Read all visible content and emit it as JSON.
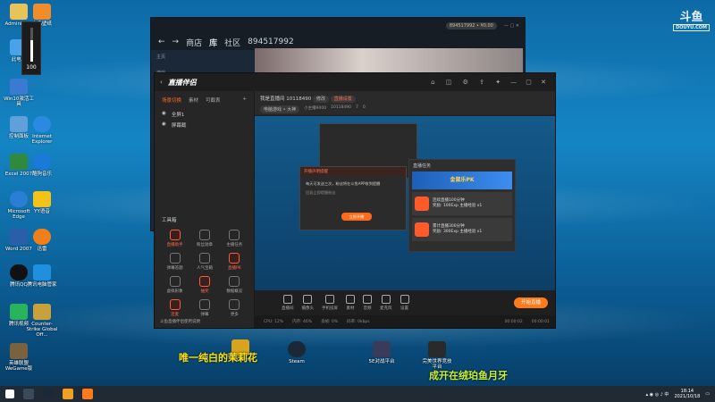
{
  "desktop": {
    "icons_left": [
      {
        "label": "Administr..."
      },
      {
        "label": "此电脑"
      },
      {
        "label": "Win10激活工具"
      },
      {
        "label": "控制面板"
      },
      {
        "label": "Excel 2007"
      },
      {
        "label": "Microsoft Edge"
      },
      {
        "label": "Word 2007"
      },
      {
        "label": "腾讯QQ"
      },
      {
        "label": "腾讯视频"
      },
      {
        "label": "英雄联盟 WeGame版"
      }
    ],
    "icons_col2": [
      {
        "label": "小鸟壁纸"
      },
      {
        "label": "Internet Explorer"
      },
      {
        "label": "酷狗音乐"
      },
      {
        "label": "YY语音"
      },
      {
        "label": "迅雷"
      },
      {
        "label": "腾讯电脑管家"
      },
      {
        "label": "Counter-Strike Global Off..."
      }
    ],
    "icons_bottom": [
      {
        "label": "WeGame"
      },
      {
        "label": "Steam"
      },
      {
        "label": "5E对战平台"
      },
      {
        "label": "完美世界竞技平台"
      }
    ],
    "volume_value": "100",
    "overlay_text_1": "唯一纯白的茉莉花",
    "overlay_text_2": "成开在绒珀鱼月牙",
    "watermark_top": "斗鱼",
    "watermark_sub": "DOUYU.COM"
  },
  "steam": {
    "nav_store": "商店",
    "nav_library": "库",
    "nav_community": "社区",
    "username": "894517992",
    "home_label": "主页",
    "games_label": "游戏",
    "account_pill": "894517992 • ¥0.00"
  },
  "streamer": {
    "app_name": "直播伴侣",
    "left_tabs": [
      "场景切换",
      "素材",
      "可截表"
    ],
    "scenes": [
      "全屏1",
      "屏幕截"
    ],
    "room_title": "我是直播间 10118490",
    "room_tag": "修改",
    "room_tag2": "直播设置",
    "header_row": [
      "电脑游戏 • 大神",
      "小主播9000",
      "10118490",
      "7",
      "0"
    ],
    "tools_title": "工具箱",
    "tools": [
      {
        "label": "直播助手",
        "hot": true
      },
      {
        "label": "粉丝勋章",
        "hot": false
      },
      {
        "label": "主播任务",
        "hot": false
      },
      {
        "label": "弹幕答题",
        "hot": false
      },
      {
        "label": "人气宝箱",
        "hot": false
      },
      {
        "label": "直播PK",
        "hot": true
      },
      {
        "label": "虚拟形象",
        "hot": false
      },
      {
        "label": "抽奖",
        "hot": true
      },
      {
        "label": "数据概览",
        "hot": false
      },
      {
        "label": "连麦",
        "hot": true
      },
      {
        "label": "弹幕",
        "hot": false
      },
      {
        "label": "更多",
        "hot": false
      }
    ],
    "notice": "斗鱼直播伴侣使用说明",
    "controls": [
      "直播间",
      "摄像头",
      "手机投屏",
      "素材",
      "音频",
      "麦克风",
      "设置"
    ],
    "start_button": "开始直播",
    "status_items": [
      "CPU: 12%",
      "内存: 46%",
      "丢帧: 0%",
      "码率: 0kbps",
      "00:00:02",
      "00:00:01"
    ],
    "dialog_title": "开播声明提醒",
    "dialog_text": "每天可发送三次，粉丝将在斗鱼APP收到提醒",
    "dialog_sub": "回复立即提醒粉丝",
    "dialog_button": "立即开播",
    "task_title": "直播任务",
    "task_banner": "金鼠乐PK",
    "tasks": [
      {
        "title": "连续直播100分钟",
        "reward": "奖励: 100Exp 主播经验 x1"
      },
      {
        "title": "累计直播300分钟",
        "reward": "奖励: 300Exp 主播经验 x1"
      }
    ]
  },
  "taskbar": {
    "time": "18:14",
    "date": "2021/10/18"
  }
}
